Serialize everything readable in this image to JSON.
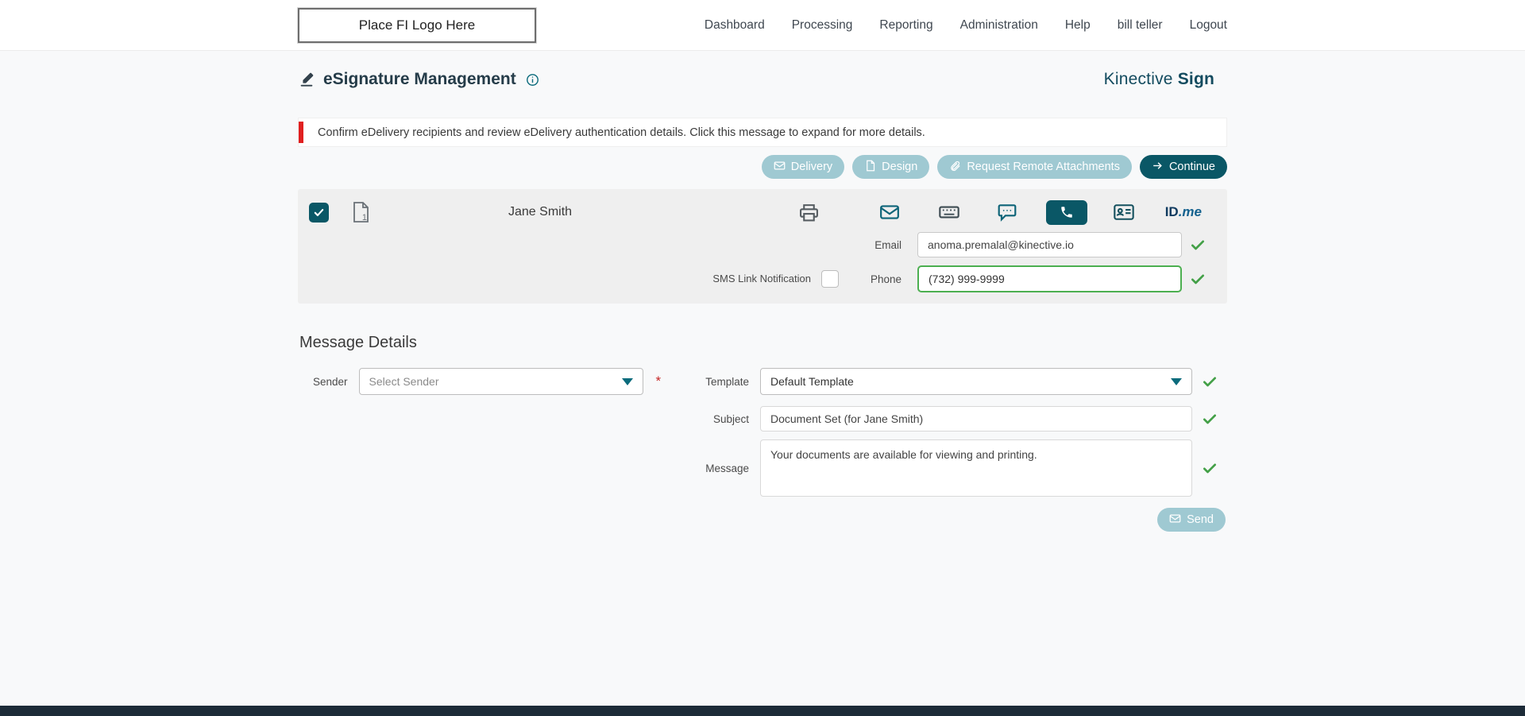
{
  "colors": {
    "accent_dark": "#0a5766",
    "accent_light": "#9fc9d2",
    "brand": "#134b5f",
    "success": "#43a047",
    "alert_red": "#e01f1f"
  },
  "header": {
    "logo_text": "Place FI Logo Here",
    "nav": [
      "Dashboard",
      "Processing",
      "Reporting",
      "Administration",
      "Help",
      "bill teller",
      "Logout"
    ]
  },
  "page": {
    "title": "eSignature Management",
    "brand_name": "Kinective",
    "brand_product": "Sign",
    "alert_text": "Confirm eDelivery recipients and review eDelivery authentication details. Click this message to expand for more details."
  },
  "toolbar": {
    "delivery": "Delivery",
    "design": "Design",
    "request_remote_attachments": "Request Remote Attachments",
    "continue_label": "Continue"
  },
  "recipient": {
    "name": "Jane Smith",
    "document_count": "1",
    "email_label": "Email",
    "email_value": "anoma.premalal@kinective.io",
    "sms_link_label": "SMS Link Notification",
    "phone_label": "Phone",
    "phone_value": "(732) 999-9999",
    "idme_id": "ID",
    "idme_me": ".me"
  },
  "message_details": {
    "heading": "Message Details",
    "sender_label": "Sender",
    "sender_value": "Select Sender",
    "required_marker": "*",
    "template_label": "Template",
    "template_value": "Default Template",
    "subject_label": "Subject",
    "subject_value": "Document Set (for Jane Smith)",
    "message_label": "Message",
    "message_value": "Your documents are available for viewing and printing.",
    "send_label": "Send"
  }
}
